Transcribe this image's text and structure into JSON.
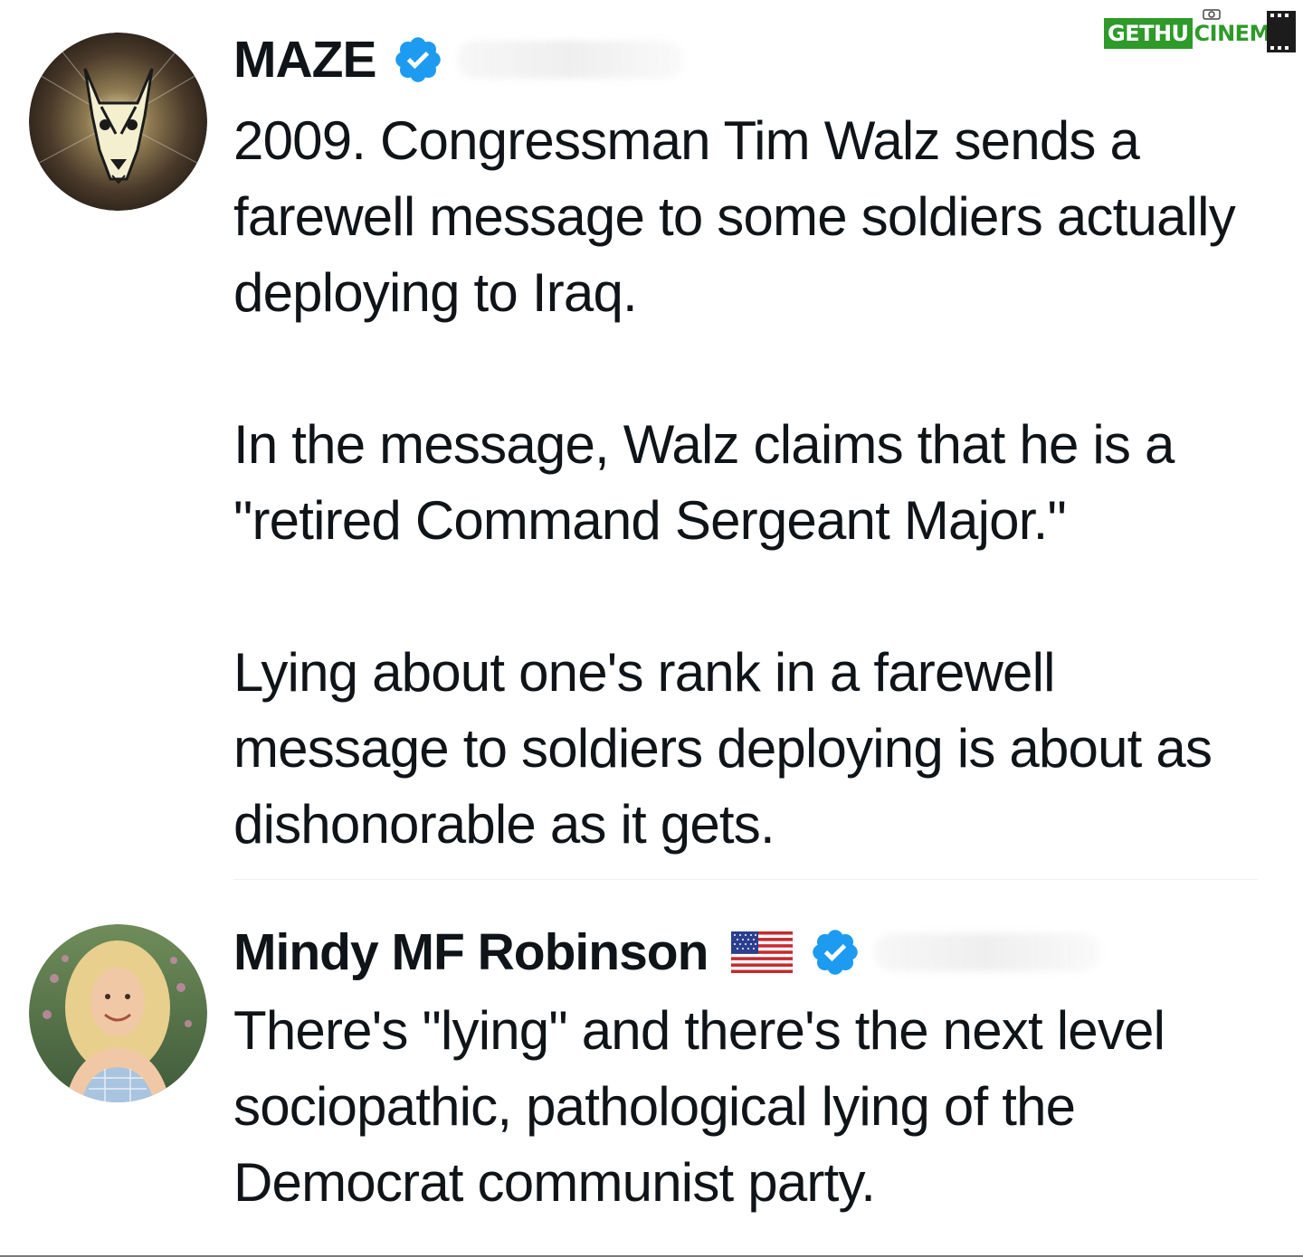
{
  "watermark": {
    "left": "GETHU",
    "right": "CINEMA"
  },
  "tweets": [
    {
      "display_name": "MAZE",
      "verified": true,
      "paragraphs": [
        "2009. Congressman Tim Walz sends a farewell message to some soldiers actually deploying to Iraq.",
        "In the message, Walz claims that he is a \"retired Command Sergeant Major.\"",
        "Lying about one's rank in a farewell message to soldiers deploying is about as dishonorable as it gets."
      ]
    },
    {
      "display_name": "Mindy MF Robinson",
      "verified": true,
      "paragraphs": [
        "There's \"lying\" and there's the next level sociopathic, pathological lying of the Democrat communist party."
      ]
    }
  ],
  "colors": {
    "text": "#0f1419",
    "verified_badge": "#1d9bf0",
    "watermark_green": "#2e9a2a"
  },
  "icons": {
    "verified": "verified-badge-icon",
    "flag": "us-flag-icon",
    "avatar_1": "doberman-avatar",
    "avatar_2": "person-avatar"
  }
}
